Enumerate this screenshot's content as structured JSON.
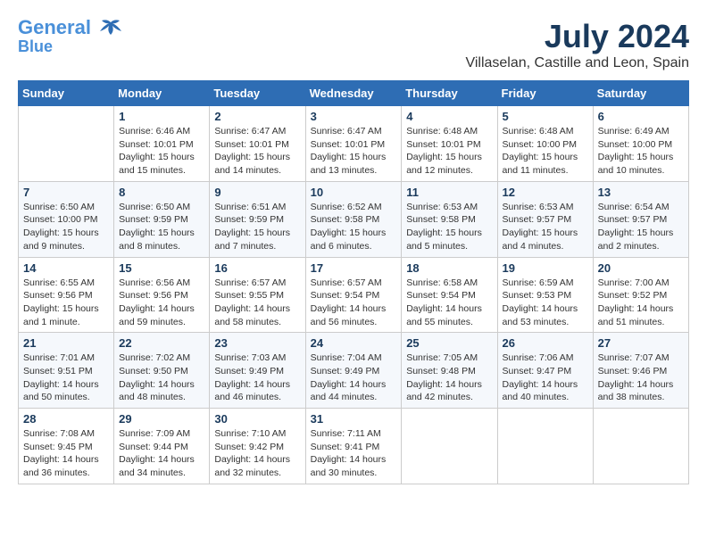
{
  "header": {
    "logo_line1": "General",
    "logo_line2": "Blue",
    "month_year": "July 2024",
    "location": "Villaselan, Castille and Leon, Spain"
  },
  "days_of_week": [
    "Sunday",
    "Monday",
    "Tuesday",
    "Wednesday",
    "Thursday",
    "Friday",
    "Saturday"
  ],
  "weeks": [
    [
      {
        "day": "",
        "sunrise": "",
        "sunset": "",
        "daylight": ""
      },
      {
        "day": "1",
        "sunrise": "Sunrise: 6:46 AM",
        "sunset": "Sunset: 10:01 PM",
        "daylight": "Daylight: 15 hours and 15 minutes."
      },
      {
        "day": "2",
        "sunrise": "Sunrise: 6:47 AM",
        "sunset": "Sunset: 10:01 PM",
        "daylight": "Daylight: 15 hours and 14 minutes."
      },
      {
        "day": "3",
        "sunrise": "Sunrise: 6:47 AM",
        "sunset": "Sunset: 10:01 PM",
        "daylight": "Daylight: 15 hours and 13 minutes."
      },
      {
        "day": "4",
        "sunrise": "Sunrise: 6:48 AM",
        "sunset": "Sunset: 10:01 PM",
        "daylight": "Daylight: 15 hours and 12 minutes."
      },
      {
        "day": "5",
        "sunrise": "Sunrise: 6:48 AM",
        "sunset": "Sunset: 10:00 PM",
        "daylight": "Daylight: 15 hours and 11 minutes."
      },
      {
        "day": "6",
        "sunrise": "Sunrise: 6:49 AM",
        "sunset": "Sunset: 10:00 PM",
        "daylight": "Daylight: 15 hours and 10 minutes."
      }
    ],
    [
      {
        "day": "7",
        "sunrise": "Sunrise: 6:50 AM",
        "sunset": "Sunset: 10:00 PM",
        "daylight": "Daylight: 15 hours and 9 minutes."
      },
      {
        "day": "8",
        "sunrise": "Sunrise: 6:50 AM",
        "sunset": "Sunset: 9:59 PM",
        "daylight": "Daylight: 15 hours and 8 minutes."
      },
      {
        "day": "9",
        "sunrise": "Sunrise: 6:51 AM",
        "sunset": "Sunset: 9:59 PM",
        "daylight": "Daylight: 15 hours and 7 minutes."
      },
      {
        "day": "10",
        "sunrise": "Sunrise: 6:52 AM",
        "sunset": "Sunset: 9:58 PM",
        "daylight": "Daylight: 15 hours and 6 minutes."
      },
      {
        "day": "11",
        "sunrise": "Sunrise: 6:53 AM",
        "sunset": "Sunset: 9:58 PM",
        "daylight": "Daylight: 15 hours and 5 minutes."
      },
      {
        "day": "12",
        "sunrise": "Sunrise: 6:53 AM",
        "sunset": "Sunset: 9:57 PM",
        "daylight": "Daylight: 15 hours and 4 minutes."
      },
      {
        "day": "13",
        "sunrise": "Sunrise: 6:54 AM",
        "sunset": "Sunset: 9:57 PM",
        "daylight": "Daylight: 15 hours and 2 minutes."
      }
    ],
    [
      {
        "day": "14",
        "sunrise": "Sunrise: 6:55 AM",
        "sunset": "Sunset: 9:56 PM",
        "daylight": "Daylight: 15 hours and 1 minute."
      },
      {
        "day": "15",
        "sunrise": "Sunrise: 6:56 AM",
        "sunset": "Sunset: 9:56 PM",
        "daylight": "Daylight: 14 hours and 59 minutes."
      },
      {
        "day": "16",
        "sunrise": "Sunrise: 6:57 AM",
        "sunset": "Sunset: 9:55 PM",
        "daylight": "Daylight: 14 hours and 58 minutes."
      },
      {
        "day": "17",
        "sunrise": "Sunrise: 6:57 AM",
        "sunset": "Sunset: 9:54 PM",
        "daylight": "Daylight: 14 hours and 56 minutes."
      },
      {
        "day": "18",
        "sunrise": "Sunrise: 6:58 AM",
        "sunset": "Sunset: 9:54 PM",
        "daylight": "Daylight: 14 hours and 55 minutes."
      },
      {
        "day": "19",
        "sunrise": "Sunrise: 6:59 AM",
        "sunset": "Sunset: 9:53 PM",
        "daylight": "Daylight: 14 hours and 53 minutes."
      },
      {
        "day": "20",
        "sunrise": "Sunrise: 7:00 AM",
        "sunset": "Sunset: 9:52 PM",
        "daylight": "Daylight: 14 hours and 51 minutes."
      }
    ],
    [
      {
        "day": "21",
        "sunrise": "Sunrise: 7:01 AM",
        "sunset": "Sunset: 9:51 PM",
        "daylight": "Daylight: 14 hours and 50 minutes."
      },
      {
        "day": "22",
        "sunrise": "Sunrise: 7:02 AM",
        "sunset": "Sunset: 9:50 PM",
        "daylight": "Daylight: 14 hours and 48 minutes."
      },
      {
        "day": "23",
        "sunrise": "Sunrise: 7:03 AM",
        "sunset": "Sunset: 9:49 PM",
        "daylight": "Daylight: 14 hours and 46 minutes."
      },
      {
        "day": "24",
        "sunrise": "Sunrise: 7:04 AM",
        "sunset": "Sunset: 9:49 PM",
        "daylight": "Daylight: 14 hours and 44 minutes."
      },
      {
        "day": "25",
        "sunrise": "Sunrise: 7:05 AM",
        "sunset": "Sunset: 9:48 PM",
        "daylight": "Daylight: 14 hours and 42 minutes."
      },
      {
        "day": "26",
        "sunrise": "Sunrise: 7:06 AM",
        "sunset": "Sunset: 9:47 PM",
        "daylight": "Daylight: 14 hours and 40 minutes."
      },
      {
        "day": "27",
        "sunrise": "Sunrise: 7:07 AM",
        "sunset": "Sunset: 9:46 PM",
        "daylight": "Daylight: 14 hours and 38 minutes."
      }
    ],
    [
      {
        "day": "28",
        "sunrise": "Sunrise: 7:08 AM",
        "sunset": "Sunset: 9:45 PM",
        "daylight": "Daylight: 14 hours and 36 minutes."
      },
      {
        "day": "29",
        "sunrise": "Sunrise: 7:09 AM",
        "sunset": "Sunset: 9:44 PM",
        "daylight": "Daylight: 14 hours and 34 minutes."
      },
      {
        "day": "30",
        "sunrise": "Sunrise: 7:10 AM",
        "sunset": "Sunset: 9:42 PM",
        "daylight": "Daylight: 14 hours and 32 minutes."
      },
      {
        "day": "31",
        "sunrise": "Sunrise: 7:11 AM",
        "sunset": "Sunset: 9:41 PM",
        "daylight": "Daylight: 14 hours and 30 minutes."
      },
      {
        "day": "",
        "sunrise": "",
        "sunset": "",
        "daylight": ""
      },
      {
        "day": "",
        "sunrise": "",
        "sunset": "",
        "daylight": ""
      },
      {
        "day": "",
        "sunrise": "",
        "sunset": "",
        "daylight": ""
      }
    ]
  ]
}
